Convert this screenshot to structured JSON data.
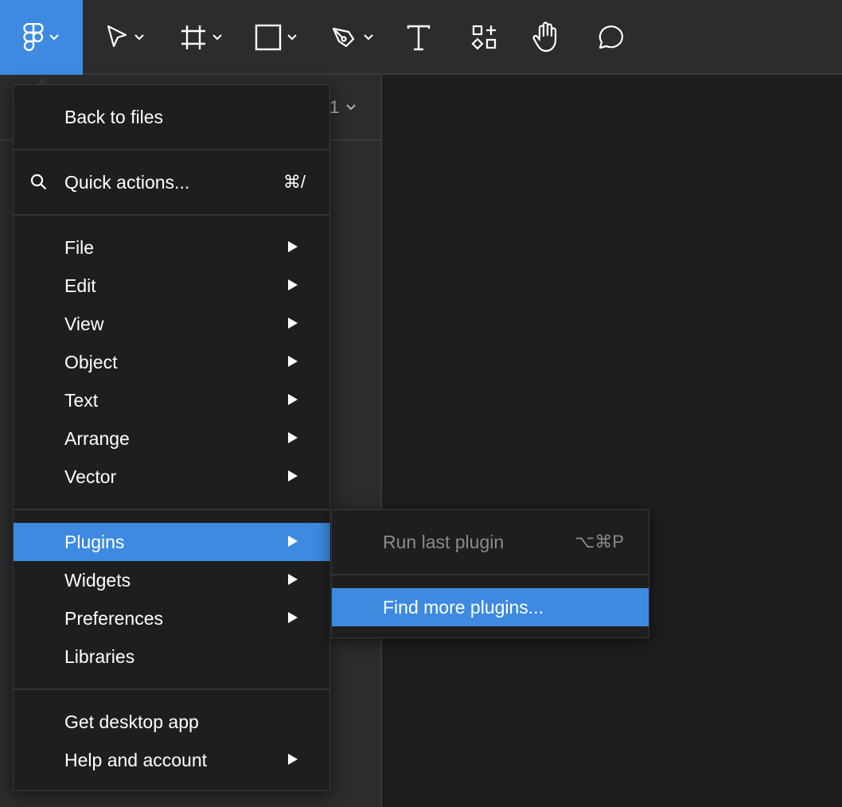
{
  "colors": {
    "accent": "#3d8ae0",
    "toolbar_bg": "#2c2c2c",
    "menu_bg": "#1e1e1e",
    "disabled_text": "#8a8a8a"
  },
  "toolbar": {
    "tools": [
      {
        "icon": "figma-logo-icon"
      },
      {
        "icon": "move-tool-icon"
      },
      {
        "icon": "frame-tool-icon"
      },
      {
        "icon": "rectangle-tool-icon"
      },
      {
        "icon": "pen-tool-icon"
      },
      {
        "icon": "text-tool-icon"
      },
      {
        "icon": "resources-icon"
      },
      {
        "icon": "hand-tool-icon"
      },
      {
        "icon": "comment-icon"
      }
    ]
  },
  "sidebar": {
    "page_label": "1"
  },
  "menu": {
    "back": "Back to files",
    "quick_actions": "Quick actions...",
    "quick_actions_shortcut": "⌘/",
    "items": [
      "File",
      "Edit",
      "View",
      "Object",
      "Text",
      "Arrange",
      "Vector"
    ],
    "group2": [
      "Plugins",
      "Widgets",
      "Preferences",
      "Libraries"
    ],
    "desktop": "Get desktop app",
    "help": "Help and account"
  },
  "submenu": {
    "run_last": "Run last plugin",
    "run_last_shortcut": "⌥⌘P",
    "find_more": "Find more plugins..."
  }
}
